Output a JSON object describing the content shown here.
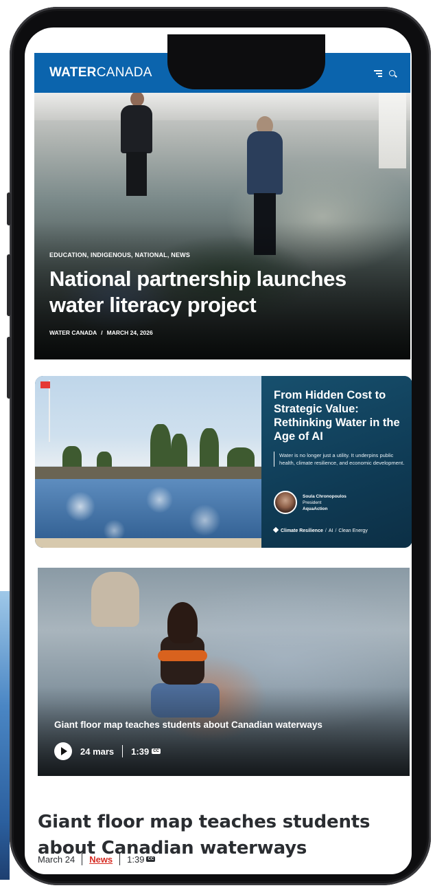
{
  "header": {
    "logo_bold": "WATER",
    "logo_light": "CANADA",
    "menu_icon": "menu-icon",
    "search_icon": "search-icon"
  },
  "hero": {
    "categories": "EDUCATION, INDIGENOUS, NATIONAL, NEWS",
    "title": "National partnership launches water literacy project",
    "author": "WATER CANADA",
    "separator": "/",
    "date": "MARCH 24, 2026"
  },
  "feature_card": {
    "title": "From Hidden Cost to Strategic Value: Rethinking Water in the Age of AI",
    "description": "Water is no longer just a utility. It underpins public health, climate resilience, and economic development.",
    "author_name": "Soula Chronopoulos",
    "author_role": "President",
    "author_org": "AquaAction",
    "tags": [
      "Climate Resilience",
      "AI",
      "Clean Energy"
    ]
  },
  "video_card": {
    "caption": "Giant floor map teaches students about Canadian waterways",
    "date": "24 mars",
    "duration": "1:39",
    "cc": "CC"
  },
  "story": {
    "title": "Giant floor map teaches students about Canadian waterways",
    "date": "March 24",
    "section": "News",
    "duration": "1:39",
    "cc": "CC"
  },
  "colors": {
    "header_blue": "#0b64ad",
    "panel_teal": "#0f3b55",
    "news_red": "#d62b22"
  }
}
